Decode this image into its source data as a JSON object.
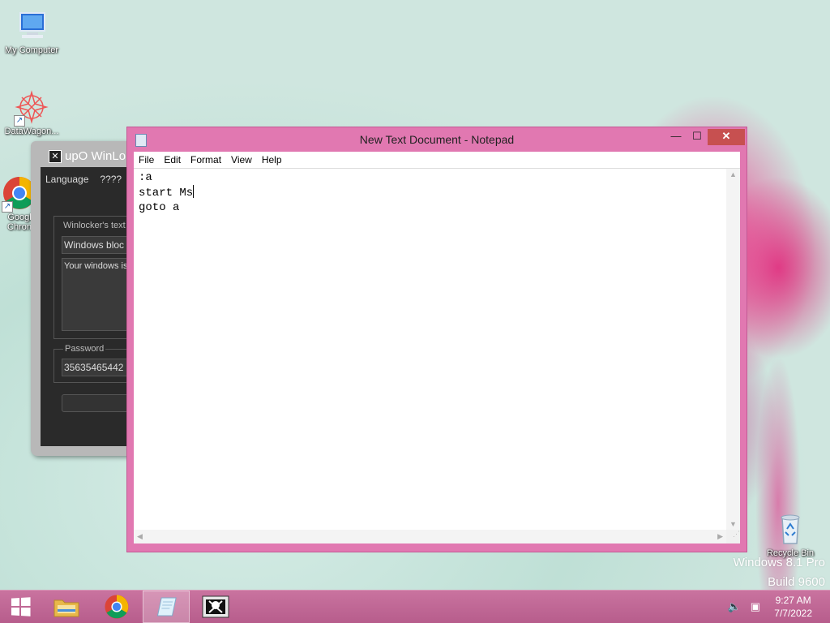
{
  "desktop": {
    "icons": [
      {
        "label": "My Computer",
        "icon": "computer-icon"
      },
      {
        "label": "DataWagon...",
        "icon": "datawagon-icon"
      },
      {
        "label": "Googl Chron",
        "icon": "chrome-icon"
      },
      {
        "label": "Recycle Bin",
        "icon": "recycle-bin-icon"
      }
    ],
    "watermark_line1": "Windows 8.1 Pro",
    "watermark_line2": "Build 9600"
  },
  "winlocker": {
    "title": "upO WinLo",
    "menu": [
      "Language",
      "????"
    ],
    "text_label": "Winlocker's text",
    "title_field": "Windows bloc",
    "body_field": "Your windows is",
    "password_label": "Password",
    "password_value": "35635465442"
  },
  "notepad": {
    "title": "New Text Document - Notepad",
    "menu": [
      "File",
      "Edit",
      "Format",
      "View",
      "Help"
    ],
    "lines": [
      ":a",
      "start Ms",
      "goto a"
    ],
    "controls": {
      "minimize": "—",
      "maximize": "☐",
      "close": "✕"
    }
  },
  "taskbar": {
    "items": [
      {
        "name": "start-button",
        "icon": "windows-logo-icon"
      },
      {
        "name": "file-explorer",
        "icon": "folder-icon"
      },
      {
        "name": "chrome",
        "icon": "chrome-icon"
      },
      {
        "name": "notepad",
        "icon": "notepad-icon",
        "active": true
      },
      {
        "name": "winlocker",
        "icon": "skull-icon"
      }
    ],
    "clock_time": "9:27 AM",
    "clock_date": "7/7/2022"
  },
  "colors": {
    "accent": "#e178b1",
    "close": "#c75050",
    "taskbar": "#c06a96"
  }
}
